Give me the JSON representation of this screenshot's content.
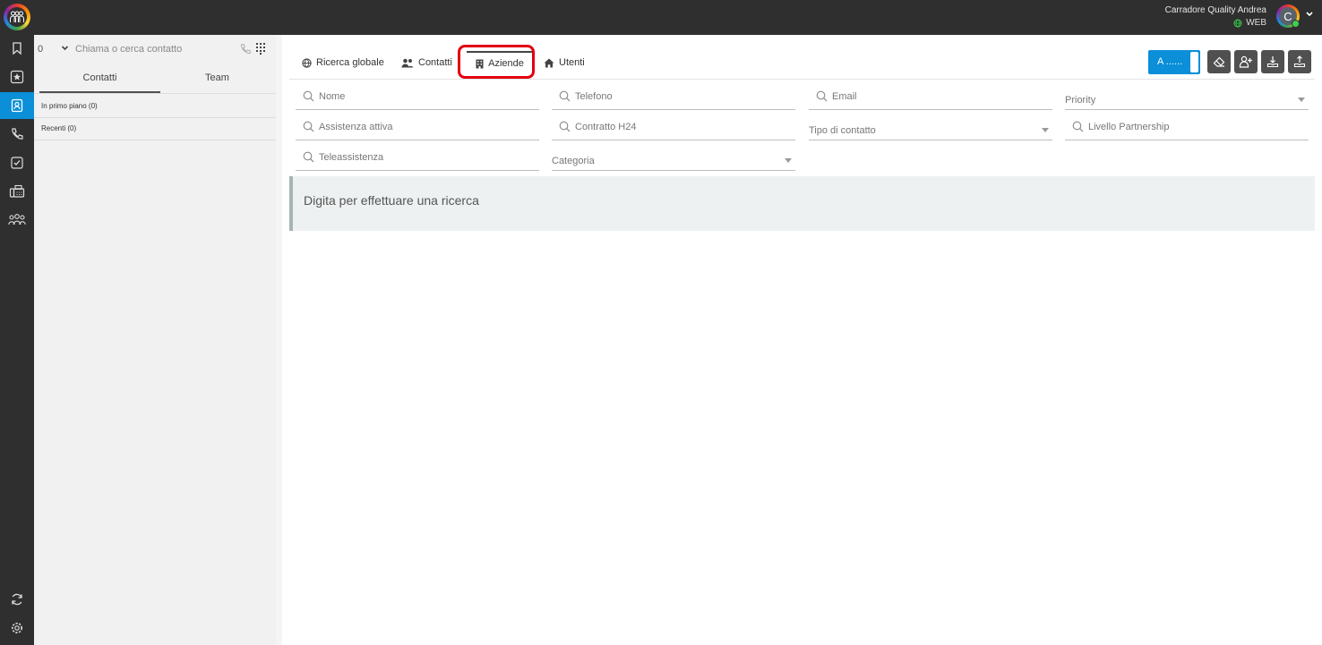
{
  "topbar": {
    "user_name": "Carradore Quality Andrea",
    "status_label": "WEB",
    "avatar_initial": "C"
  },
  "sidebar": {
    "items": [
      {
        "icon": "bookmark-icon"
      },
      {
        "icon": "star-icon"
      },
      {
        "icon": "contacts-icon",
        "active": true
      },
      {
        "icon": "phone-icon"
      },
      {
        "icon": "tasks-icon"
      },
      {
        "icon": "fax-icon"
      },
      {
        "icon": "group-icon"
      }
    ],
    "bottom_items": [
      {
        "icon": "sync-icon"
      },
      {
        "icon": "settings-icon"
      }
    ]
  },
  "panel": {
    "prefix": "0",
    "search_placeholder": "Chiama o cerca contatto",
    "tabs": [
      "Contatti",
      "Team"
    ],
    "lists": [
      "In primo piano (0)",
      "Recenti (0)"
    ]
  },
  "main": {
    "tabs": [
      {
        "label": "Ricerca globale",
        "icon": "globe-icon"
      },
      {
        "label": "Contatti",
        "icon": "users-icon"
      },
      {
        "label": "Aziende",
        "icon": "building-icon",
        "active": true
      },
      {
        "label": "Utenti",
        "icon": "home-icon"
      }
    ],
    "toggle_label": "A ......",
    "fields": {
      "nome": "Nome",
      "telefono": "Telefono",
      "email": "Email",
      "priority": "Priority",
      "assistenza_attiva": "Assistenza attiva",
      "contratto_h24": "Contratto H24",
      "tipo_di_contatto": "Tipo di contatto",
      "livello_partnership": "Livello Partnership",
      "teleassistenza": "Teleassistenza",
      "categoria": "Categoria"
    },
    "message": "Digita per effettuare una ricerca"
  },
  "colors": {
    "accent": "#0a8fd8",
    "topbar": "#2f2f2f",
    "highlight": "#e3000f"
  }
}
